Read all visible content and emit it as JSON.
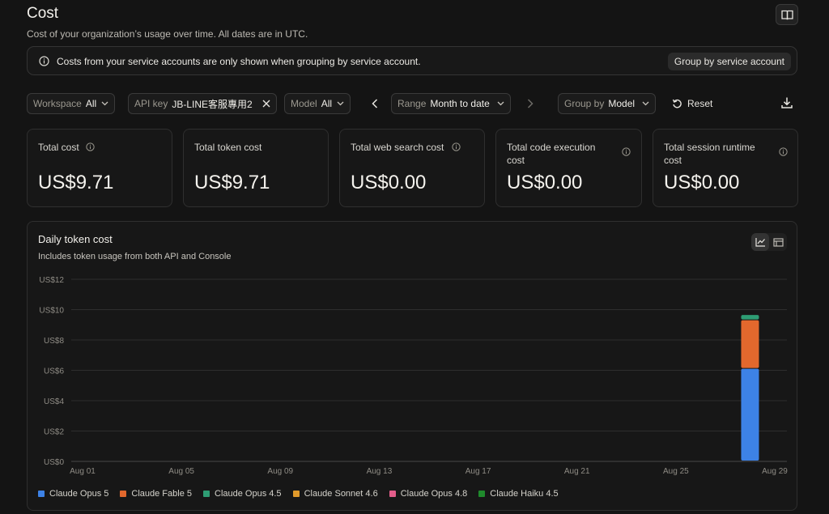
{
  "header": {
    "title": "Cost",
    "subtitle": "Cost of your organization’s usage over time. All dates are in UTC.",
    "docs_icon": "book-icon"
  },
  "notice": {
    "text": "Costs from your service accounts are only shown when grouping by service account.",
    "button_label": "Group by service account",
    "icon": "info-icon"
  },
  "filters": {
    "workspace": {
      "label": "Workspace",
      "value": "All"
    },
    "api_key": {
      "label": "API key",
      "value": "JB-LINE客服專用2"
    },
    "model": {
      "label": "Model",
      "value": "All"
    },
    "range": {
      "label": "Range",
      "value": "Month to date"
    },
    "group_by": {
      "label": "Group by",
      "value": "Model"
    },
    "reset_label": "Reset"
  },
  "summary_cards": [
    {
      "label": "Total cost",
      "value": "US$9.71",
      "has_info": true
    },
    {
      "label": "Total token cost",
      "value": "US$9.71",
      "has_info": false
    },
    {
      "label": "Total web search cost",
      "value": "US$0.00",
      "has_info": true
    },
    {
      "label": "Total code execution cost",
      "value": "US$0.00",
      "has_info": true
    },
    {
      "label": "Total session runtime cost",
      "value": "US$0.00",
      "has_info": true
    }
  ],
  "chart": {
    "title": "Daily token cost",
    "subtitle": "Includes token usage from both API and Console"
  },
  "colors": {
    "Claude Opus 5": "#3d82e6",
    "Claude Fable 5": "#e2682d",
    "Claude Opus 4.5": "#2e9d74",
    "Claude Sonnet 4.6": "#e09a2b",
    "Claude Opus 4.8": "#e25d8a",
    "Claude Haiku 4.5": "#1f8a2c"
  },
  "chart_data": {
    "type": "bar",
    "stacked": true,
    "x_tick_labels": [
      "Aug 01",
      "Aug 05",
      "Aug 09",
      "Aug 13",
      "Aug 17",
      "Aug 21",
      "Aug 25",
      "Aug 29"
    ],
    "y_tick_labels": [
      "US$0",
      "US$2",
      "US$4",
      "US$6",
      "US$8",
      "US$10",
      "US$12"
    ],
    "ylim": [
      0,
      12
    ],
    "grid": true,
    "legend_position": "bottom-left",
    "categories": [
      "Aug 28"
    ],
    "series": [
      {
        "name": "Claude Opus 5",
        "values": [
          6.1
        ]
      },
      {
        "name": "Claude Fable 5",
        "values": [
          3.2
        ]
      },
      {
        "name": "Claude Opus 4.5",
        "values": [
          0.35
        ]
      },
      {
        "name": "Claude Sonnet 4.6",
        "values": [
          0
        ]
      },
      {
        "name": "Claude Opus 4.8",
        "values": [
          0
        ]
      },
      {
        "name": "Claude Haiku 4.5",
        "values": [
          0
        ]
      }
    ]
  }
}
